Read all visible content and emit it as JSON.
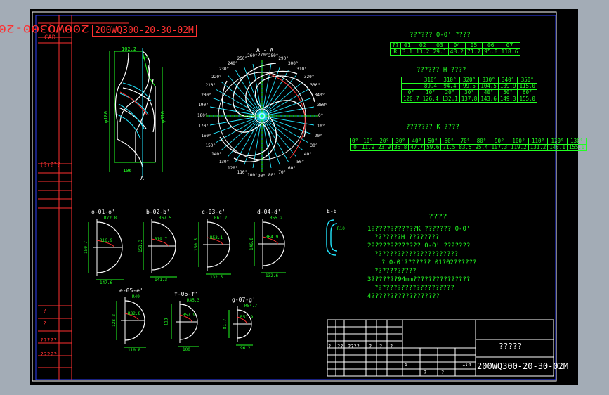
{
  "titleblock_left": {
    "title": "200WQ300-20-30-02M",
    "cad": "CAD",
    "label1": "(?)???",
    "r1": "?",
    "r2": "?",
    "r3": "?????",
    "r4": "?????"
  },
  "view_aa": {
    "title": "A - A"
  },
  "angle_labels": [
    "0°",
    "10°",
    "20°",
    "30°",
    "40°",
    "50°",
    "60°",
    "70°",
    "80°",
    "90°",
    "100°",
    "110°",
    "120°",
    "130°",
    "140°",
    "150°",
    "160°",
    "170°",
    "180°",
    "190°",
    "200°",
    "210°",
    "220°",
    "230°",
    "240°",
    "250°",
    "260°",
    "270°",
    "280°",
    "290°",
    "300°",
    "310°",
    "320°",
    "330°",
    "340°",
    "350°"
  ],
  "table1": {
    "title": "?????? 0-0' ????",
    "row1": [
      "??",
      "01",
      "02",
      "03",
      "04",
      "05",
      "06",
      "07"
    ],
    "row2": [
      "R",
      "3.1",
      "13.2",
      "29.1",
      "48.2",
      "71.7",
      "95.0",
      "118.6"
    ]
  },
  "table2": {
    "title": "?????? H ????",
    "row1": [
      "",
      "310°",
      "310°",
      "320°",
      "330°",
      "340°",
      "350°"
    ],
    "row2": [
      "",
      "89.4",
      "94.4",
      "99.5",
      "104.5",
      "109.9",
      "115.0"
    ],
    "row3": [
      "0°",
      "10°",
      "20°",
      "30°",
      "40°",
      "50°",
      "60°"
    ],
    "row4": [
      "120.7",
      "126.4",
      "132.1",
      "137.8",
      "143.6",
      "149.3",
      "155.0"
    ]
  },
  "table3": {
    "title": "??????? K ????",
    "row1": [
      "0°",
      "10°",
      "20°",
      "30°",
      "40°",
      "50°",
      "60°",
      "70°",
      "80°",
      "90°",
      "100°",
      "110°",
      "120°",
      "130°"
    ],
    "row2": [
      "0",
      "11.9",
      "23.9",
      "35.8",
      "47.7",
      "59.6",
      "71.5",
      "83.5",
      "95.4",
      "107.3",
      "119.2",
      "131.2",
      "143.1",
      "155.0"
    ]
  },
  "section_ee": {
    "title": "E-E",
    "r": "R10"
  },
  "profile_dims": {
    "d1": "102.2",
    "d2": "94",
    "d3": "106",
    "d4": "φ180",
    "d5": "φ310",
    "a": "A"
  },
  "sections": [
    {
      "title": "o-01-o'",
      "r": "R72.8",
      "r2": "R16.9",
      "h": "150.7",
      "w": "147.6"
    },
    {
      "title": "b-02-b'",
      "r": "R67.5",
      "r2": "R19.7",
      "h": "151.3",
      "w": "141.3"
    },
    {
      "title": "c-03-c'",
      "r": "R61.2",
      "r2": "R53.1",
      "h": "150.5",
      "w": "132.5"
    },
    {
      "title": "d-04-d'",
      "r": "R55.2",
      "r2": "R64.9",
      "h": "146.8",
      "w": "132.6"
    },
    {
      "title": "e-05-e'",
      "r": "R49",
      "r2": "R82.8",
      "h": "128.2",
      "w": "110.8"
    },
    {
      "title": "f-06-f'",
      "r": "R45.3",
      "r2": "R57.9",
      "h": "118",
      "w": "100"
    },
    {
      "title": "g-07-g'",
      "r": "R54.7",
      "r2": "R51.9",
      "h": "81.7",
      "w": "96.2"
    }
  ],
  "notes": {
    "title": "????",
    "lines": [
      "1????????????K ??????? 0-0'",
      "???????H ????????",
      "2????????????? 0-0' ???????",
      "??????????????????????",
      "? 0-0'??????? 01?02??????",
      "???????????",
      "3???????94mm???????????????",
      "?????????????????????",
      "4??????????????????"
    ]
  },
  "title_block": {
    "name": "?????",
    "code": "200WQ300-20-30-02M",
    "c1": "?",
    "c2": "??",
    "c3": "????",
    "c4": "?",
    "c5": "?",
    "c6": "?",
    "c7": "5",
    "c8": "1:4",
    "c9": "?",
    "c10": "?"
  }
}
